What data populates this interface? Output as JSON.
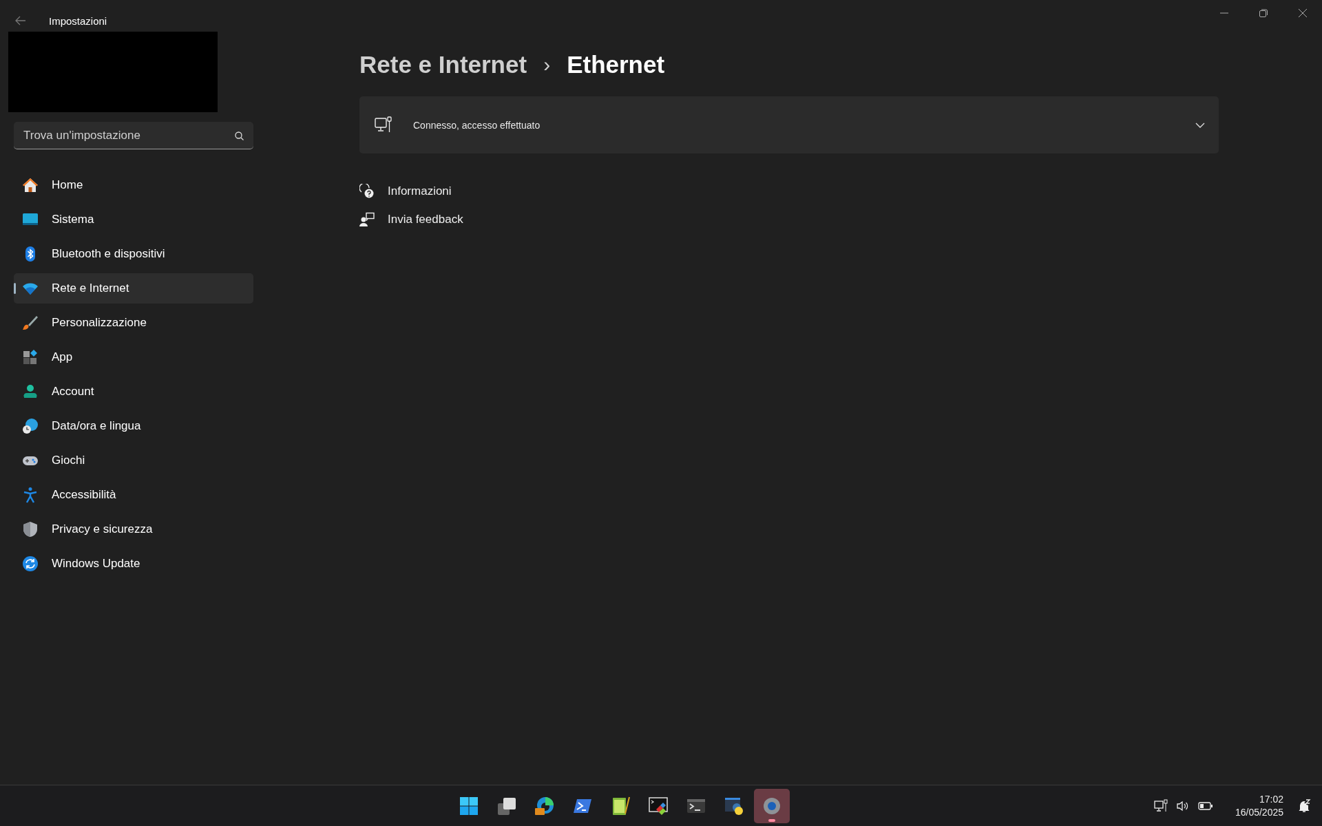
{
  "window": {
    "title": "Impostazioni"
  },
  "search": {
    "placeholder": "Trova un'impostazione"
  },
  "sidebar": {
    "items": [
      {
        "label": "Home",
        "selected": false
      },
      {
        "label": "Sistema",
        "selected": false
      },
      {
        "label": "Bluetooth e dispositivi",
        "selected": false
      },
      {
        "label": "Rete e Internet",
        "selected": true
      },
      {
        "label": "Personalizzazione",
        "selected": false
      },
      {
        "label": "App",
        "selected": false
      },
      {
        "label": "Account",
        "selected": false
      },
      {
        "label": "Data/ora e lingua",
        "selected": false
      },
      {
        "label": "Giochi",
        "selected": false
      },
      {
        "label": "Accessibilità",
        "selected": false
      },
      {
        "label": "Privacy e sicurezza",
        "selected": false
      },
      {
        "label": "Windows Update",
        "selected": false
      }
    ]
  },
  "breadcrumb": {
    "parent": "Rete e Internet",
    "separator": "›",
    "current": "Ethernet"
  },
  "connection_card": {
    "status": "Connesso, accesso effettuato",
    "expanded": false
  },
  "links": [
    "Informazioni",
    "Invia feedback"
  ],
  "taskbar": {
    "apps": [
      {
        "selected": false
      },
      {
        "selected": false
      },
      {
        "selected": false
      },
      {
        "selected": false
      },
      {
        "selected": false
      },
      {
        "selected": false
      },
      {
        "selected": false
      },
      {
        "selected": false
      },
      {
        "selected": true
      }
    ],
    "time": "17:02",
    "date": "16/05/2025"
  }
}
